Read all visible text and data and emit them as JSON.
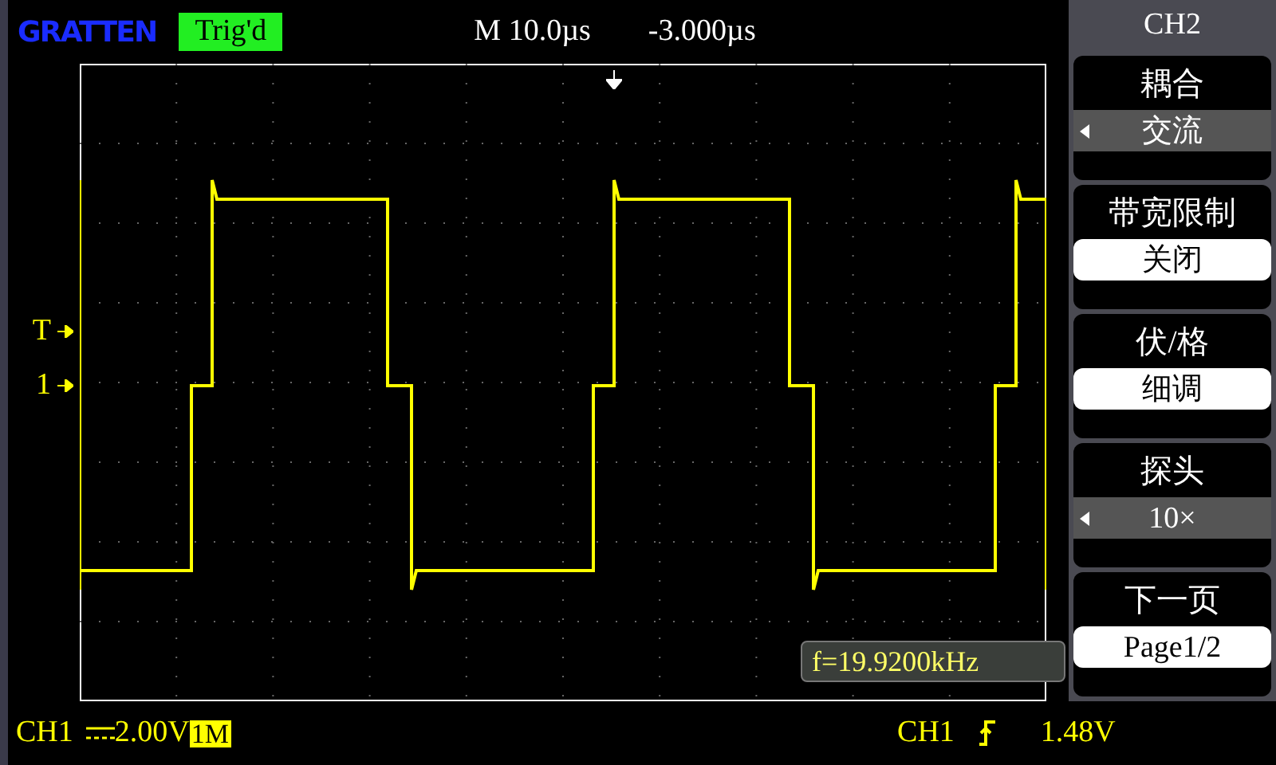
{
  "top_bar": {
    "logo": "GRATTEN",
    "trigger_status": "Trig'd",
    "timebase": "M 10.0µs",
    "trigger_offset": "-3.000µs"
  },
  "markers": [
    {
      "label": "T"
    },
    {
      "label": "1"
    }
  ],
  "measurement": "f=19.9200kHz",
  "menu": {
    "title": "CH2",
    "items": [
      {
        "label": "耦合",
        "value": "交流",
        "kind": "cycle"
      },
      {
        "label": "带宽限制",
        "value": "关闭",
        "kind": "button"
      },
      {
        "label": "伏/格",
        "value": "细调",
        "kind": "button"
      },
      {
        "label": "探头",
        "value": "10×",
        "kind": "cycle"
      },
      {
        "label": "下一页",
        "value": "Page1/2",
        "kind": "button"
      }
    ]
  },
  "status_bar": {
    "channel": "CH1",
    "scale": "2.00V",
    "impedance": "1M",
    "trigger_source": "CH1",
    "trigger_level": "1.48V"
  }
}
